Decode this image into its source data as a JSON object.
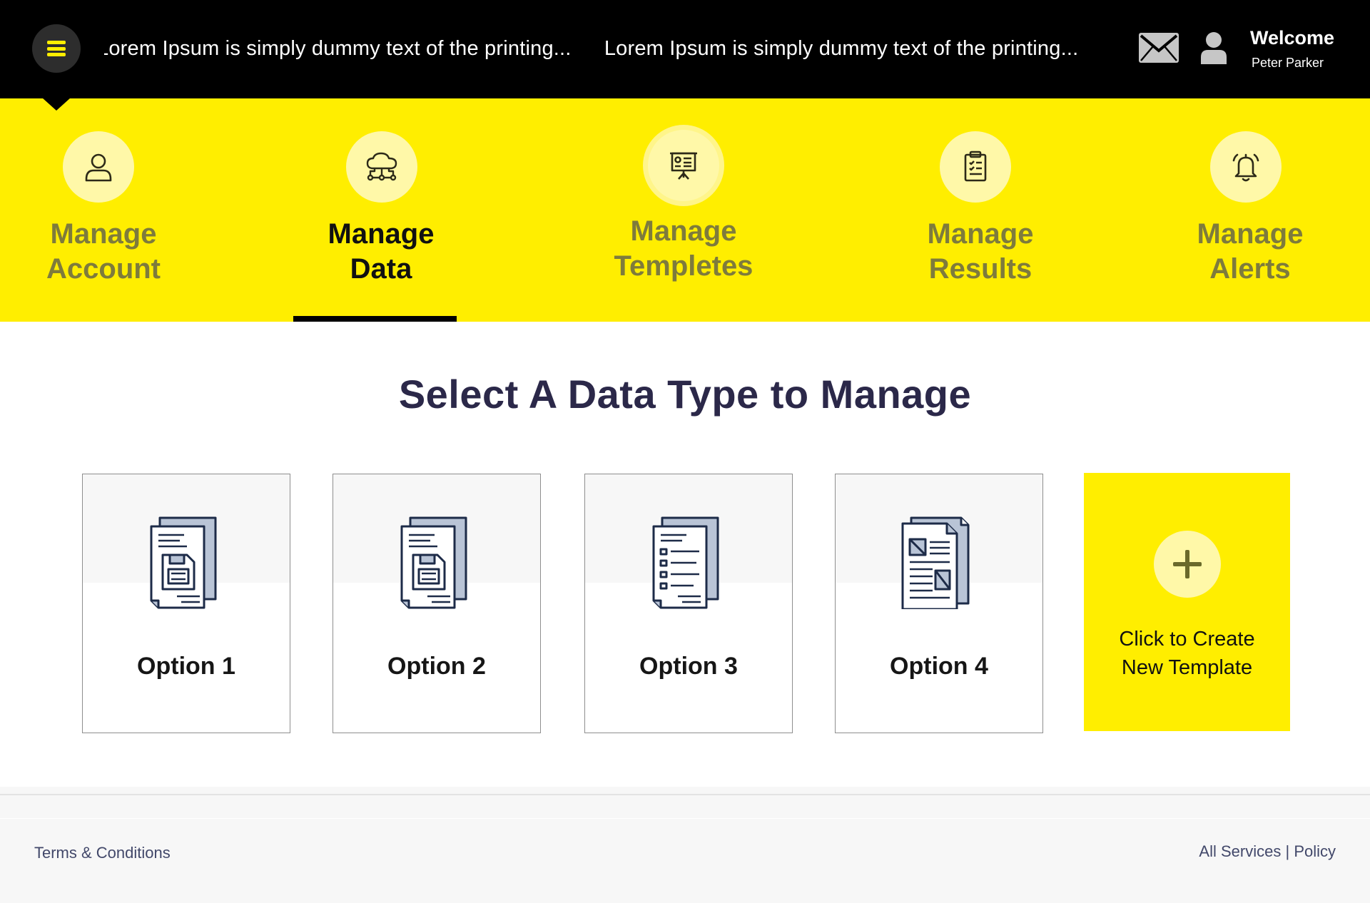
{
  "header": {
    "ticker_items": [
      "Lorem Ipsum is simply dummy text of the printing...",
      "Lorem Ipsum is simply dummy text of the printing..."
    ],
    "welcome": "Welcome",
    "user_name": "Peter Parker",
    "icons": {
      "menu": "hamburger-icon",
      "mail": "envelope-icon",
      "user": "user-icon"
    }
  },
  "nav": {
    "items": [
      {
        "line1": "Manage",
        "line2": "Account",
        "icon": "user-outline-icon",
        "active": false
      },
      {
        "line1": "Manage",
        "line2": "Data",
        "icon": "cloud-network-icon",
        "active": true
      },
      {
        "line1": "Manage",
        "line2": "Templetes",
        "icon": "presentation-board-icon",
        "active": false
      },
      {
        "line1": "Manage",
        "line2": "Results",
        "icon": "clipboard-checklist-icon",
        "active": false
      },
      {
        "line1": "Manage",
        "line2": "Alerts",
        "icon": "bell-icon",
        "active": false
      }
    ]
  },
  "main": {
    "title": "Select A Data Type to Manage",
    "options": [
      {
        "label": "Option 1",
        "icon": "document-floppy-icon"
      },
      {
        "label": "Option 2",
        "icon": "document-floppy-icon"
      },
      {
        "label": "Option 3",
        "icon": "document-list-icon"
      },
      {
        "label": "Option 4",
        "icon": "document-images-icon"
      }
    ],
    "create": {
      "line1": "Click to Create",
      "line2": "New Template",
      "icon": "plus-icon"
    }
  },
  "footer": {
    "terms": "Terms & Conditions",
    "all_services": "All Services",
    "separator": "|",
    "policy": "Policy"
  },
  "colors": {
    "brand_yellow": "#ffee00",
    "circle_yellow": "#fff8a8",
    "topbar_black": "#000000",
    "nav_text_inactive": "#7e7b3c",
    "title_navy": "#2b2849",
    "icon_navy": "#1d2b48",
    "icon_blue_gray": "#b9c4d6"
  }
}
